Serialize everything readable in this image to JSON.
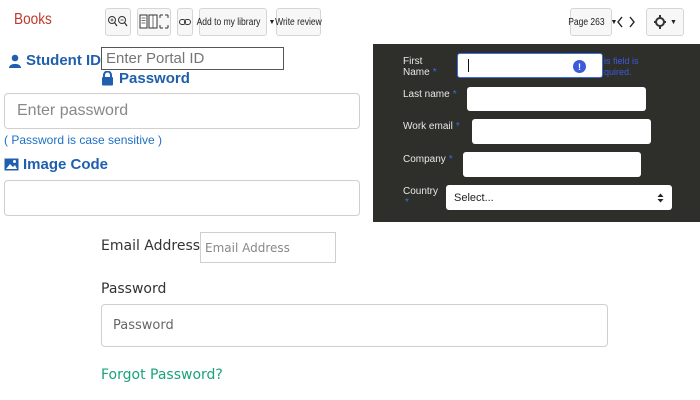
{
  "toolbar": {
    "brand": "Books",
    "zoom_in_icon": "zoom-in-icon",
    "zoom_out_icon": "zoom-out-icon",
    "view_icon": "page-view-icon",
    "fullscreen_icon": "fullscreen-icon",
    "link_icon": "link-icon",
    "add_library_label": "Add to my library",
    "write_review_label": "Write review",
    "page_label": "Page 263",
    "prev_icon": "chevron-left-icon",
    "next_icon": "chevron-right-icon",
    "settings_icon": "gear-icon"
  },
  "student_form": {
    "student_id_label": "Student ID",
    "student_id_placeholder": "Enter Portal ID",
    "password_label": "Password",
    "password_placeholder": "Enter password",
    "case_note": "( Password is case sensitive )",
    "image_code_label": "Image Code",
    "colors": {
      "label": "#1f5fae",
      "note": "#1f6fc2"
    }
  },
  "dark_form": {
    "first_name_label_1": "First",
    "first_name_label_2": "Name",
    "required_star": "*",
    "error_text_1": "is field is",
    "error_text_2": "quired.",
    "last_name_label": "Last name",
    "work_email_label": "Work email",
    "company_label": "Company",
    "country_label": "Country",
    "country_value": "Select...",
    "colors": {
      "background": "#2e2f2b",
      "accent": "#3b6ee0"
    }
  },
  "login_form": {
    "email_label": "Email Address",
    "email_placeholder": "Email Address",
    "password_label": "Password",
    "password_placeholder": "Password",
    "forgot_link": "Forgot Password?",
    "colors": {
      "link": "#1aa37a"
    }
  }
}
